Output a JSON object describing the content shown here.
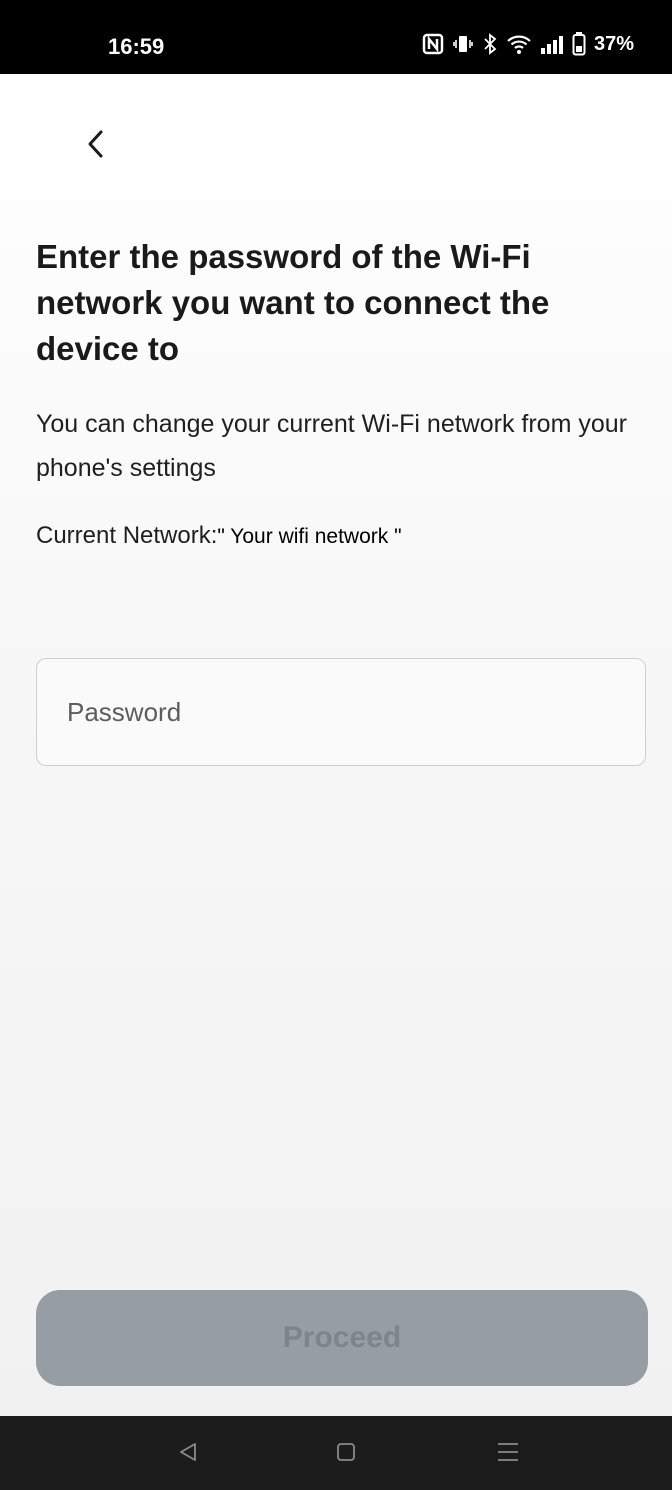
{
  "status_bar": {
    "time": "16:59",
    "battery": "37%",
    "icons": [
      "nfc-icon",
      "vibrate-icon",
      "bluetooth-icon",
      "wifi-icon",
      "signal-icon",
      "battery-icon"
    ]
  },
  "header": {
    "back_icon": "chevron-left-icon"
  },
  "main": {
    "title": "Enter the password of the Wi-Fi network you want to connect the device to",
    "subtitle": "You can change your current Wi-Fi network from your phone's settings",
    "current_network_label": "Current Network:",
    "current_network_value": "\" Your wifi network  \""
  },
  "form": {
    "password_placeholder": "Password",
    "password_value": ""
  },
  "footer": {
    "proceed_label": "Proceed"
  },
  "nav_bar": {
    "icons": [
      "back-triangle-icon",
      "home-square-icon",
      "menu-lines-icon"
    ]
  },
  "colors": {
    "proceed_background": "#979da4",
    "proceed_text": "#7d848c",
    "title_text": "#1a1a1a"
  }
}
